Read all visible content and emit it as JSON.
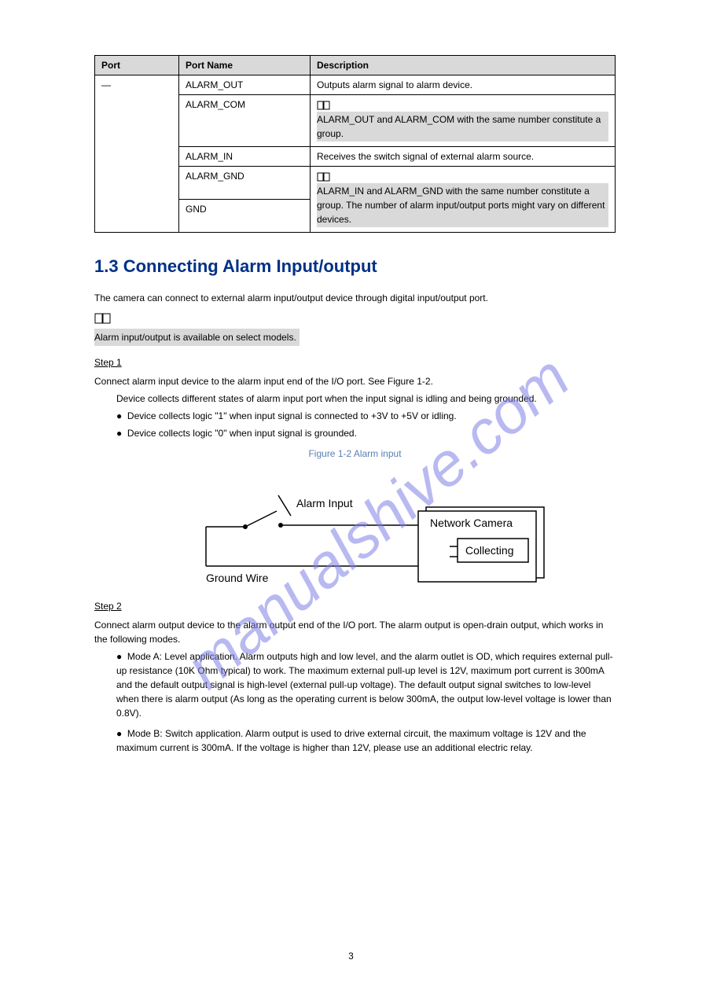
{
  "table": {
    "headers": [
      "Port",
      "Port Name",
      "Description"
    ],
    "col1_rowspan": "—",
    "rows": [
      {
        "port": "",
        "name": "ALARM_OUT",
        "desc": "Outputs alarm signal to alarm device."
      },
      {
        "port": "",
        "name": "ALARM_COM",
        "desc_pre": "",
        "desc_note": "ALARM_OUT and ALARM_COM with the same number constitute a group."
      },
      {
        "port": "",
        "name": "ALARM_IN",
        "desc": "Receives the switch signal of external alarm source."
      },
      {
        "port": "",
        "name": "ALARM_GND",
        "desc_pre": "",
        "desc_note": "ALARM_IN and ALARM_GND with the same number constitute a group. The number of alarm input/output ports might vary on different devices."
      },
      {
        "port": "",
        "name": "GND",
        "desc": ""
      }
    ]
  },
  "section": {
    "heading_number": "1.3",
    "heading_text": "Connecting Alarm Input/output",
    "intro": "The camera can connect to external alarm input/output device through digital input/output port.",
    "note": "Alarm input/output is available on select models.",
    "steps": {
      "step1": {
        "label": "Step 1",
        "text": "Connect alarm input device to the alarm input end of the I/O port. See Figure 1-2.",
        "detail": "Device collects different states of alarm input port when the input signal is idling and being grounded.",
        "bullet1": "Device collects logic \"1\" when input signal is connected to +3V to +5V or idling.",
        "bullet2": "Device collects logic \"0\" when input signal is grounded."
      },
      "step2": {
        "label": "Step 2",
        "text": "Connect alarm output device to the alarm output end of the I/O port. The alarm output is open-drain output, which works in the following modes.",
        "bullet1": "Mode A: Level application. Alarm outputs high and low level, and the alarm outlet is OD, which requires external pull-up resistance (10K Ohm typical) to work. The maximum external pull-up level is 12V, maximum port current is 300mA and the default output signal is high-level (external pull-up voltage). The default output signal switches to low-level when there is alarm output (As long as the operating current is below 300mA, the output low-level voltage is lower than 0.8V).",
        "bullet2": "Mode B: Switch application. Alarm output is used to drive external circuit, the maximum voltage is 12V and the maximum current is 300mA. If the voltage is higher than 12V, please use an additional electric relay."
      }
    },
    "figure": {
      "caption": "Figure 1-2 Alarm input",
      "labels": {
        "alarm_input": "Alarm Input",
        "ground_wire": "Ground Wire",
        "network_camera": "Network Camera",
        "collecting": "Collecting"
      }
    }
  },
  "page_number": "3"
}
